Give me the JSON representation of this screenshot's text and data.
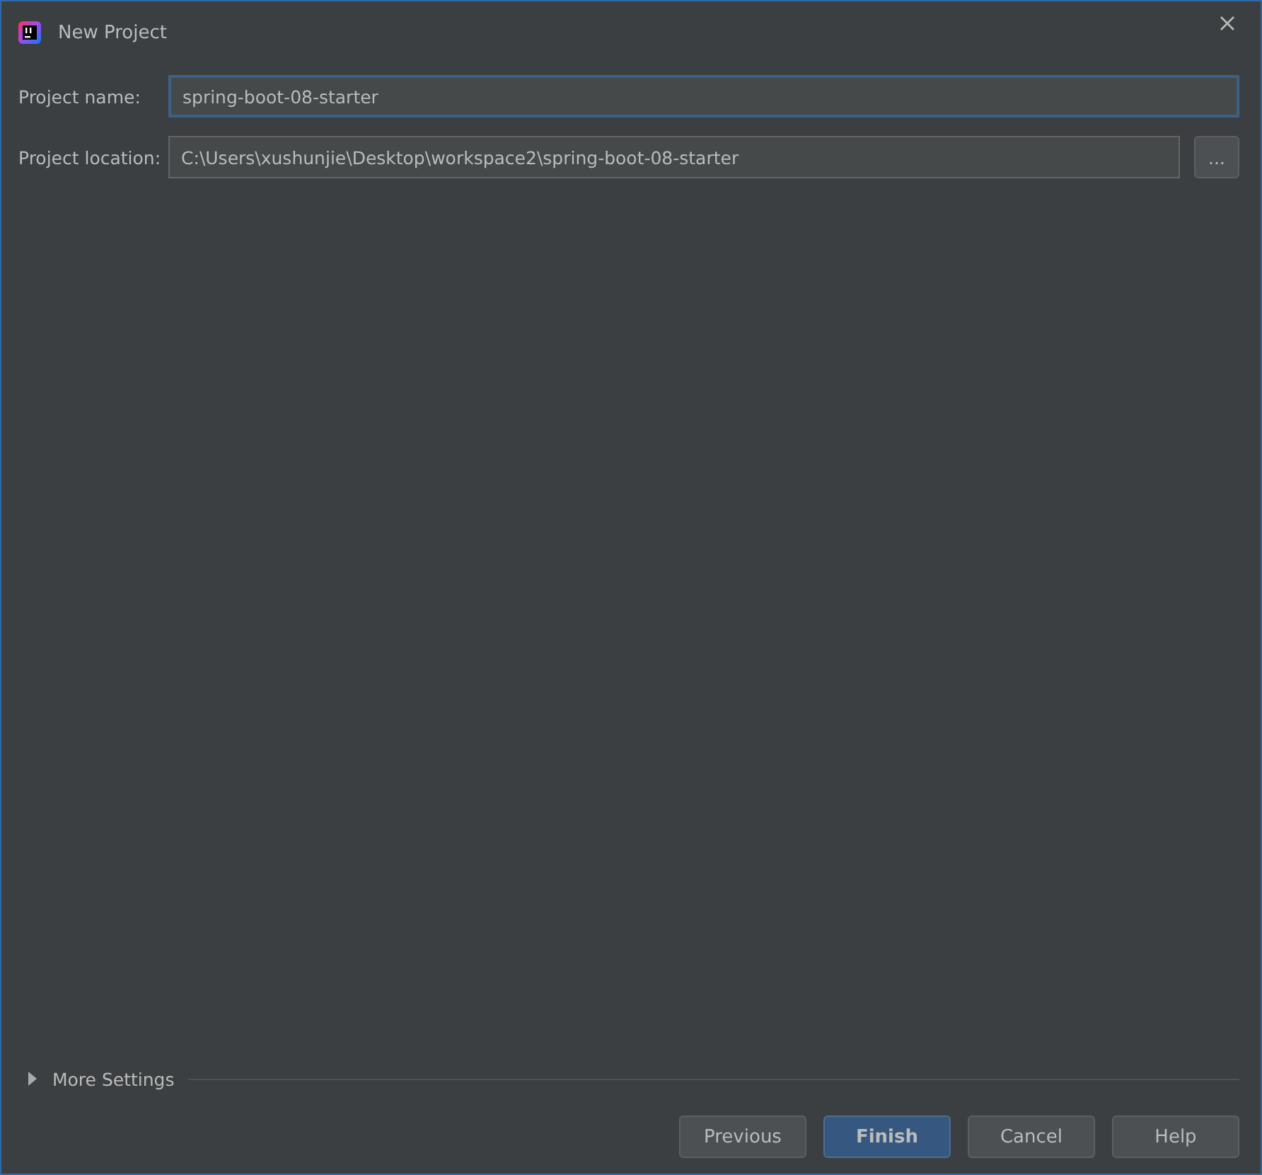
{
  "window": {
    "title": "New Project"
  },
  "fields": [
    {
      "label": "Project name:",
      "value": "spring-boot-08-starter",
      "focused": true
    },
    {
      "label": "Project location:",
      "value": "C:\\Users\\xushunjie\\Desktop\\workspace2\\spring-boot-08-starter",
      "focused": false,
      "browse_label": "..."
    }
  ],
  "more_settings": {
    "label": "More Settings",
    "expanded": false
  },
  "buttons": [
    {
      "label": "Previous",
      "kind": "default"
    },
    {
      "label": "Finish",
      "kind": "primary"
    },
    {
      "label": "Cancel",
      "kind": "default"
    },
    {
      "label": "Help",
      "kind": "default"
    }
  ]
}
